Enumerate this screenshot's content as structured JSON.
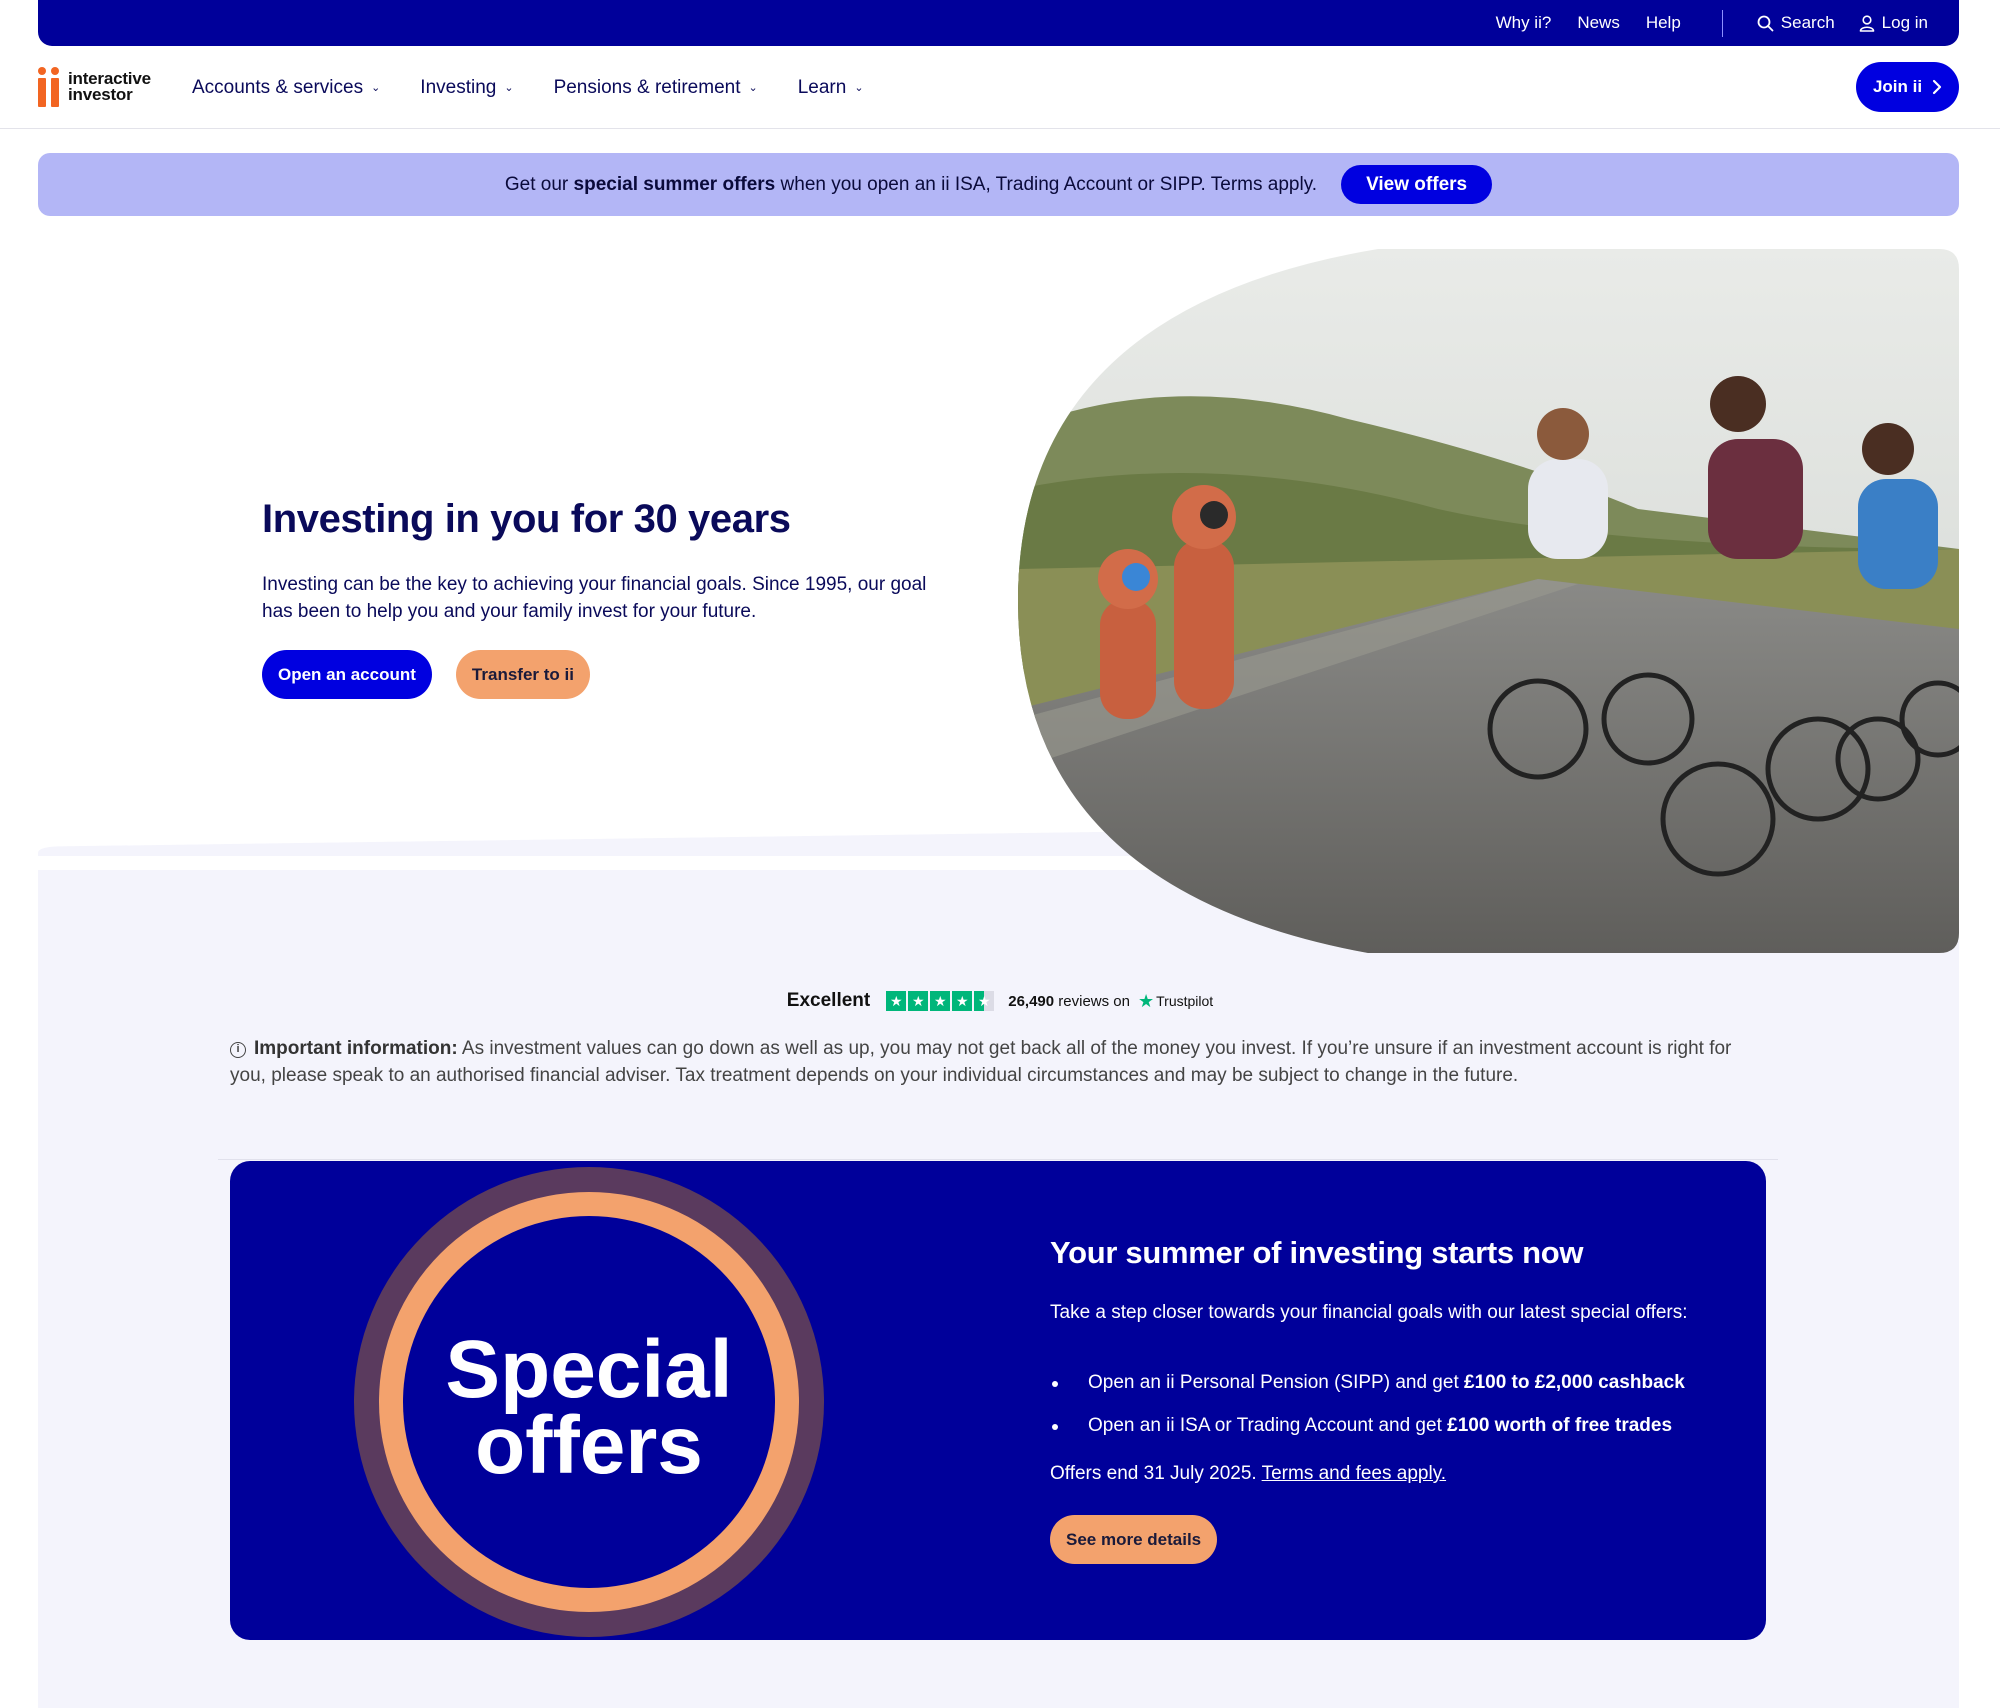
{
  "utility_bar": {
    "links": [
      "Why ii?",
      "News",
      "Help"
    ],
    "search_label": "Search",
    "login_label": "Log in"
  },
  "nav": {
    "logo_line1": "interactive",
    "logo_line2": "investor",
    "items": [
      {
        "label": "Accounts & services"
      },
      {
        "label": "Investing"
      },
      {
        "label": "Pensions & retirement"
      },
      {
        "label": "Learn"
      }
    ],
    "join_label": "Join ii"
  },
  "promo": {
    "text_before": "Get our ",
    "text_bold": "special summer offers",
    "text_after": " when you open an ii ISA, Trading Account or SIPP. Terms apply.",
    "button_label": "View offers"
  },
  "hero": {
    "title": "Investing in you for 30 years",
    "description": "Investing can be the key to achieving your financial goals. Since 1995, our goal has been to help you and your family invest for your future.",
    "primary_button": "Open an account",
    "secondary_button": "Transfer to ii"
  },
  "trustpilot": {
    "rating_word": "Excellent",
    "review_count": "26,490",
    "reviews_suffix": " reviews on",
    "brand": "Trustpilot",
    "stars": 4.5
  },
  "important": {
    "label": "Important information:",
    "text": " As investment values can go down as well as up, you may not get back all of the money you invest. If you’re unsure if an investment account is right for you, please speak to an authorised financial adviser. Tax treatment depends on your individual circumstances and may be subject to change in the future."
  },
  "offers": {
    "badge_line1": "Special",
    "badge_line2": "offers",
    "title": "Your summer of investing starts now",
    "description": "Take a step closer towards your financial goals with our latest special offers:",
    "items": [
      {
        "text": "Open an ii Personal Pension (SIPP) and get ",
        "bold": "£100 to £2,000 cashback"
      },
      {
        "text": "Open an ii ISA or Trading Account and get ",
        "bold": "£100 worth of free trades"
      }
    ],
    "end_text": "Offers end 31 July 2025. ",
    "terms_link": "Terms and fees apply.",
    "button_label": "See more details"
  },
  "colors": {
    "navy": "#00009a",
    "brand_blue": "#0000e0",
    "orange": "#f3a26d",
    "lavender": "#b3b6f6",
    "logo_orange": "#f26522"
  }
}
